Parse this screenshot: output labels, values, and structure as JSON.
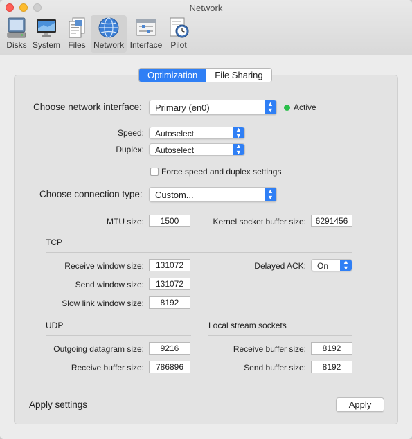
{
  "window": {
    "title": "Network"
  },
  "toolbar": {
    "items": [
      {
        "label": "Disks"
      },
      {
        "label": "System"
      },
      {
        "label": "Files"
      },
      {
        "label": "Network"
      },
      {
        "label": "Interface"
      },
      {
        "label": "Pilot"
      }
    ],
    "selected": "Network"
  },
  "tabs": [
    {
      "label": "Optimization",
      "active": true
    },
    {
      "label": "File Sharing",
      "active": false
    }
  ],
  "network": {
    "interface_label": "Choose network interface:",
    "interface_value": "Primary (en0)",
    "status": "Active",
    "status_color": "#2bbf4b",
    "speed_label": "Speed:",
    "speed_value": "Autoselect",
    "duplex_label": "Duplex:",
    "duplex_value": "Autoselect",
    "force_label": "Force speed and duplex settings",
    "force_checked": false,
    "connection_label": "Choose connection type:",
    "connection_value": "Custom...",
    "mtu_label": "MTU size:",
    "mtu_value": "1500",
    "kernel_label": "Kernel socket buffer size:",
    "kernel_value": "6291456"
  },
  "tcp": {
    "heading": "TCP",
    "receive_label": "Receive window size:",
    "receive_value": "131072",
    "send_label": "Send window size:",
    "send_value": "131072",
    "slow_label": "Slow link window size:",
    "slow_value": "8192",
    "delayed_ack_label": "Delayed ACK:",
    "delayed_ack_value": "On"
  },
  "udp": {
    "heading": "UDP",
    "outgoing_label": "Outgoing datagram size:",
    "outgoing_value": "9216",
    "receive_label": "Receive buffer size:",
    "receive_value": "786896"
  },
  "local": {
    "heading": "Local stream sockets",
    "receive_label": "Receive buffer size:",
    "receive_value": "8192",
    "send_label": "Send buffer size:",
    "send_value": "8192"
  },
  "footer": {
    "apply_label": "Apply settings",
    "apply_button": "Apply"
  },
  "colors": {
    "accent": "#2f7ff5",
    "status_green": "#2bbf4b"
  }
}
